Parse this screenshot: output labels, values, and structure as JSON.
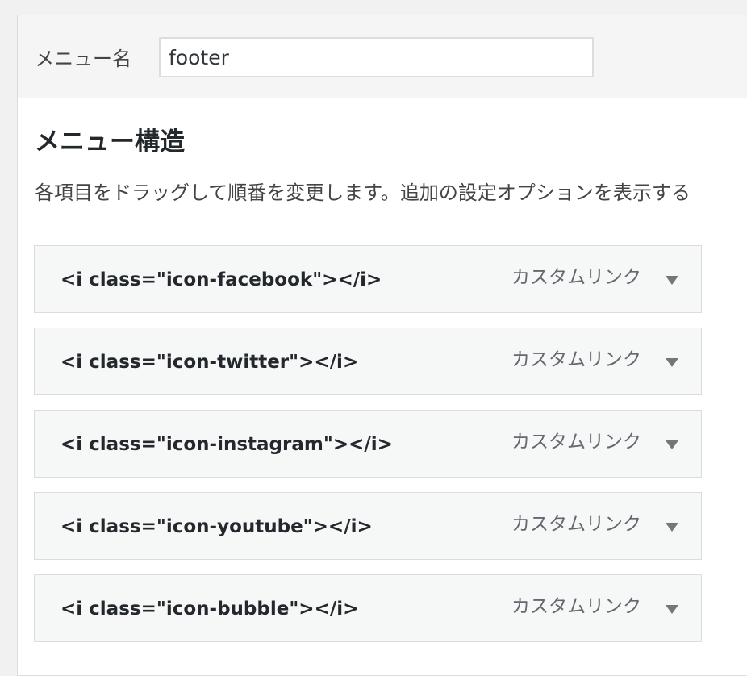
{
  "header": {
    "menu_name_label": "メニュー名",
    "menu_name_value": "footer"
  },
  "structure": {
    "title": "メニュー構造",
    "instructions": "各項目をドラッグして順番を変更します。追加の設定オプションを表示する"
  },
  "menu_items": [
    {
      "title": "<i class=\"icon-facebook\"></i>",
      "type": "カスタムリンク",
      "arrow_icon": "triangle-down-icon"
    },
    {
      "title": "<i class=\"icon-twitter\"></i>",
      "type": "カスタムリンク",
      "arrow_icon": "triangle-down-icon"
    },
    {
      "title": "<i class=\"icon-instagram\"></i>",
      "type": "カスタムリンク",
      "arrow_icon": "triangle-down-icon"
    },
    {
      "title": "<i class=\"icon-youtube\"></i>",
      "type": "カスタムリンク",
      "arrow_icon": "triangle-down-icon"
    },
    {
      "title": "<i class=\"icon-bubble\"></i>",
      "type": "カスタムリンク",
      "arrow_icon": "triangle-down-icon"
    }
  ]
}
